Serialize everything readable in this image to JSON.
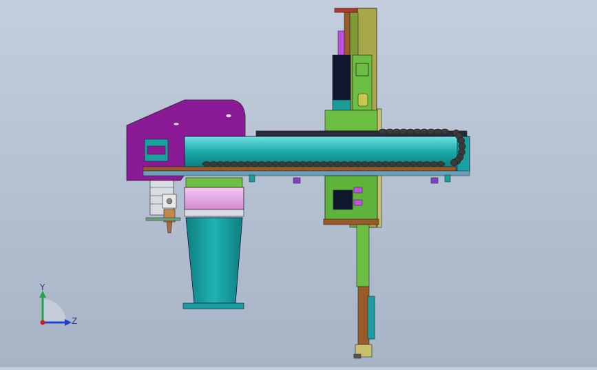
{
  "viewport": {
    "background_top": "#c3cedd",
    "background_bottom": "#a6b4c6"
  },
  "triad": {
    "y_label": "Y",
    "z_label": "Z",
    "y_color": "#22a34a",
    "z_color": "#2242c8",
    "x_color": "#d02020"
  },
  "colors": {
    "beam": "#15a3a3",
    "purple_plate": "#8a1a96",
    "green_plate": "#5fb53c",
    "olive_column": "#a8a84a",
    "brown_rail": "#9a5a2a",
    "pink_block": "#e0a0e0",
    "teal_stand": "#1aa0a0",
    "cable_chain": "#3a3a3a",
    "black_motor": "#101830"
  }
}
